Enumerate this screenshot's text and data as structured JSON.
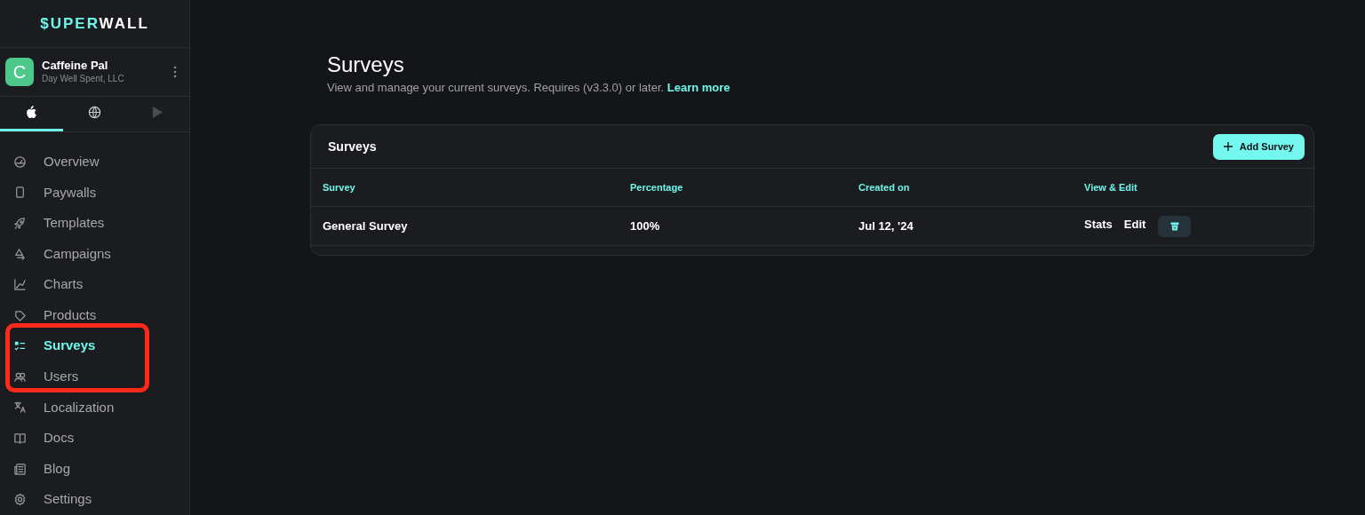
{
  "logo": {
    "accent": "$UPER",
    "rest": "WALL"
  },
  "workspace": {
    "initial": "C",
    "name": "Caffeine Pal",
    "company": "Day Well Spent, LLC"
  },
  "platform_tabs": [
    {
      "kind": "apple",
      "selected": true
    },
    {
      "kind": "web",
      "selected": false
    },
    {
      "kind": "play",
      "selected": false
    }
  ],
  "nav": [
    {
      "kind": "overview",
      "label": "Overview",
      "selected": false
    },
    {
      "kind": "paywalls",
      "label": "Paywalls",
      "selected": false
    },
    {
      "kind": "templates",
      "label": "Templates",
      "selected": false
    },
    {
      "kind": "campaigns",
      "label": "Campaigns",
      "selected": false
    },
    {
      "kind": "charts",
      "label": "Charts",
      "selected": false
    },
    {
      "kind": "products",
      "label": "Products",
      "selected": false
    },
    {
      "kind": "surveys",
      "label": "Surveys",
      "selected": true
    },
    {
      "kind": "users",
      "label": "Users",
      "selected": false
    },
    {
      "kind": "localization",
      "label": "Localization",
      "selected": false
    },
    {
      "kind": "docs",
      "label": "Docs",
      "selected": false
    },
    {
      "kind": "blog",
      "label": "Blog",
      "selected": false
    },
    {
      "kind": "settings",
      "label": "Settings",
      "selected": false
    }
  ],
  "annotation": {
    "kind": "highlight-frame",
    "color": "#ff2a1a"
  },
  "page": {
    "title": "Surveys",
    "subtitle": "View and manage your current surveys. Requires (v3.3.0) or later.",
    "link": "Learn more"
  },
  "card": {
    "title": "Surveys",
    "add_button": "Add Survey",
    "columns": [
      "Survey",
      "Percentage",
      "Created on",
      "View & Edit"
    ],
    "rows": [
      {
        "survey": "General Survey",
        "percentage": "100%",
        "created_on": "Jul 12, '24",
        "actions": [
          "Stats",
          "Edit"
        ]
      }
    ]
  }
}
